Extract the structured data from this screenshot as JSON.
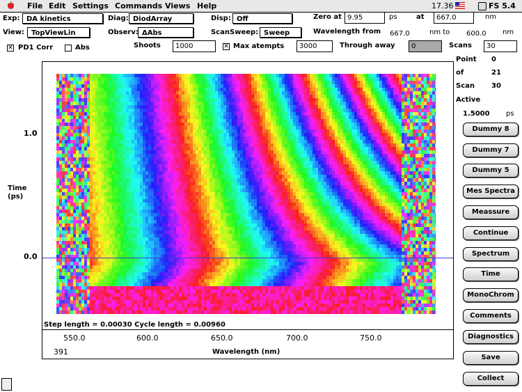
{
  "menubar": {
    "items": [
      "File",
      "Edit",
      "Settings",
      "Commands",
      "Views",
      "Help"
    ],
    "clock": "17.36",
    "app": "FS 5.4"
  },
  "controls": {
    "exp_label": "Exp:",
    "exp_value": "DA kinetics",
    "diag_label": "Diag:",
    "diag_value": "DiodArray",
    "disp_label": "Disp:",
    "disp_value": "Off",
    "zero_at_label": "Zero at",
    "zero_at_value": "9.95",
    "zero_at_unit": "ps",
    "at_label": "at",
    "at_value": "667.0",
    "at_unit": "nm",
    "view_label": "View:",
    "view_value": "TopViewLin",
    "observ_label": "Observ:",
    "observ_value": "ΔAbs",
    "scansweep_label": "ScanSweep:",
    "scansweep_value": "Sweep",
    "wl_from_label": "Wavelength from",
    "wl_from_value": "667.0",
    "wl_to_label": "nm to",
    "wl_to_value": "600.0",
    "wl_unit": "nm",
    "pd1corr_label": "PD1 Corr",
    "pd1corr_checked": true,
    "abs_label": "Abs",
    "abs_checked": false,
    "shoots_label": "Shoots",
    "shoots_value": "1000",
    "maxatt_label": "Max atempts",
    "maxatt_checked": true,
    "maxatt_value": "3000",
    "through_label": "Through away",
    "through_value": "0",
    "scans_label": "Scans",
    "scans_value": "30"
  },
  "status": {
    "point_label": "Point",
    "point_value": "0",
    "of_label": "of",
    "of_value": "21",
    "scan_label": "Scan",
    "scan_value": "30",
    "active_label": "Active",
    "active_value": "1.5000",
    "active_unit": "ps"
  },
  "buttons": [
    "Dummy 8",
    "Dummy 7",
    "Dummy 5",
    "Mes Spectra",
    "Meassure",
    "Continue",
    "Spectrum",
    "Time",
    "MonoChrom",
    "Comments",
    "Diagnostics",
    "Save",
    "Collect"
  ],
  "plot": {
    "y_title_line1": "Time",
    "y_title_line2": "(ps)",
    "y_ticks": [
      "1.0",
      "0.0"
    ],
    "step_info": "Step length = 0.00030  Cycle length = 0.00960",
    "x_ticks": [
      "550.0",
      "600.0",
      "650.0",
      "700.0",
      "750.0"
    ],
    "x_title": "Wavelength (nm)",
    "corner_value": "391"
  },
  "colors": {
    "accent_line": "#3b3bd6",
    "field_gray": "#aaaaaa"
  }
}
